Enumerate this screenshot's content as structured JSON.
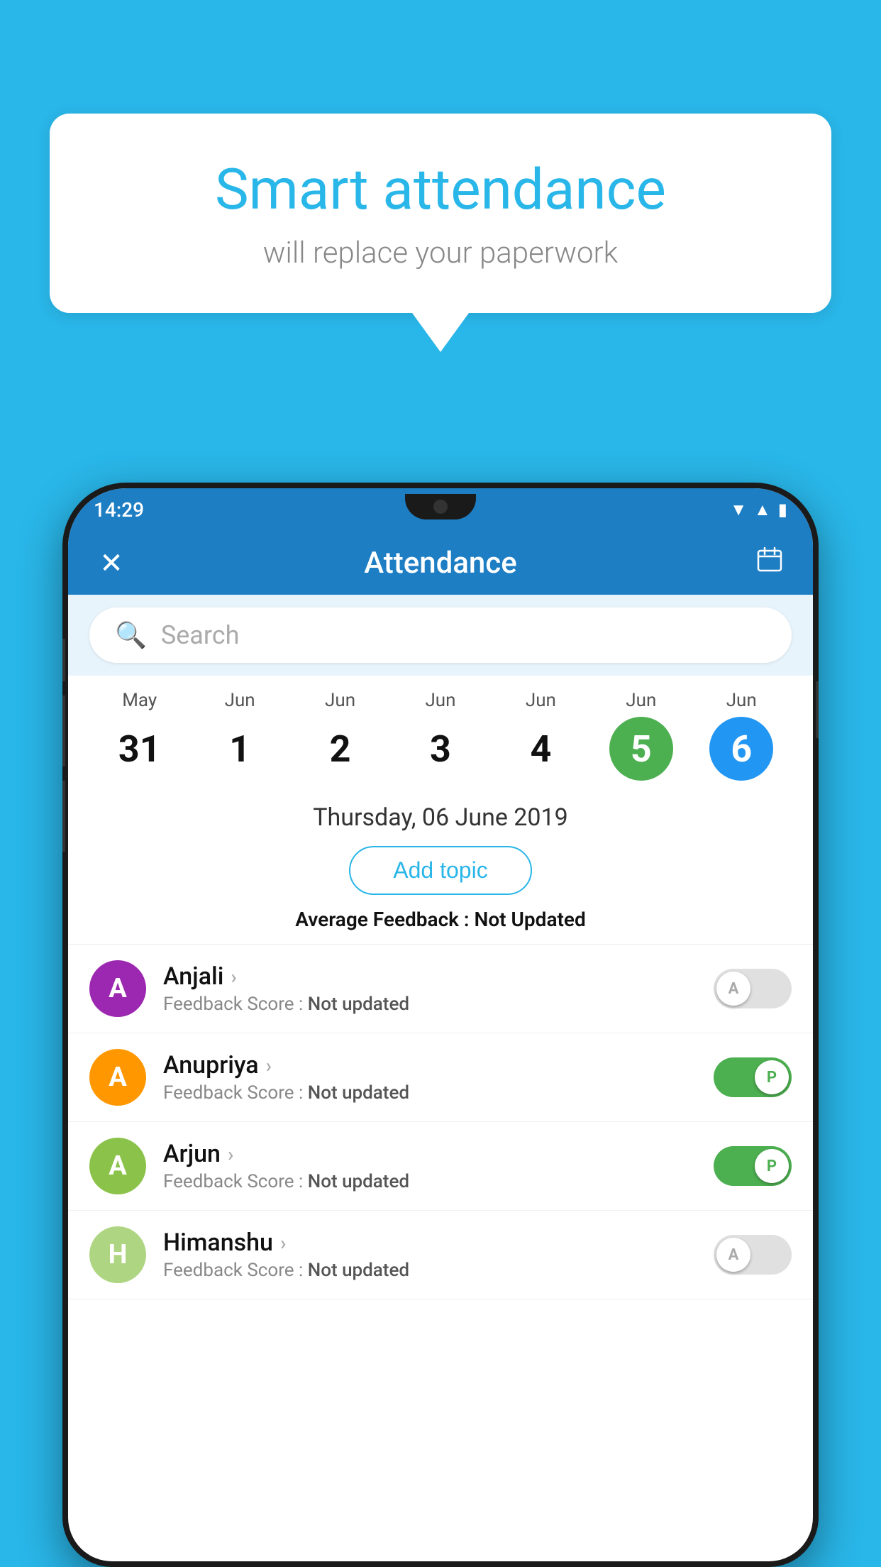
{
  "background_color": "#29b6e8",
  "speech_bubble": {
    "title": "Smart attendance",
    "subtitle": "will replace your paperwork"
  },
  "status_bar": {
    "time": "14:29",
    "icons": [
      "wifi",
      "signal",
      "battery"
    ]
  },
  "app_bar": {
    "close_icon": "✕",
    "title": "Attendance",
    "calendar_icon": "📅"
  },
  "search": {
    "placeholder": "Search"
  },
  "calendar": {
    "days": [
      {
        "month": "May",
        "date": "31",
        "style": "normal"
      },
      {
        "month": "Jun",
        "date": "1",
        "style": "normal"
      },
      {
        "month": "Jun",
        "date": "2",
        "style": "normal"
      },
      {
        "month": "Jun",
        "date": "3",
        "style": "normal"
      },
      {
        "month": "Jun",
        "date": "4",
        "style": "normal"
      },
      {
        "month": "Jun",
        "date": "5",
        "style": "green"
      },
      {
        "month": "Jun",
        "date": "6",
        "style": "blue"
      }
    ]
  },
  "selected_date": "Thursday, 06 June 2019",
  "add_topic_label": "Add topic",
  "average_feedback": {
    "label": "Average Feedback : ",
    "value": "Not Updated"
  },
  "students": [
    {
      "name": "Anjali",
      "avatar_letter": "A",
      "avatar_color": "#9c27b0",
      "feedback_label": "Feedback Score : ",
      "feedback_value": "Not updated",
      "attendance": "absent",
      "toggle_letter": "A"
    },
    {
      "name": "Anupriya",
      "avatar_letter": "A",
      "avatar_color": "#ff9800",
      "feedback_label": "Feedback Score : ",
      "feedback_value": "Not updated",
      "attendance": "present",
      "toggle_letter": "P"
    },
    {
      "name": "Arjun",
      "avatar_letter": "A",
      "avatar_color": "#8bc34a",
      "feedback_label": "Feedback Score : ",
      "feedback_value": "Not updated",
      "attendance": "present",
      "toggle_letter": "P"
    },
    {
      "name": "Himanshu",
      "avatar_letter": "H",
      "avatar_color": "#aed581",
      "feedback_label": "Feedback Score : ",
      "feedback_value": "Not updated",
      "attendance": "absent",
      "toggle_letter": "A"
    }
  ]
}
